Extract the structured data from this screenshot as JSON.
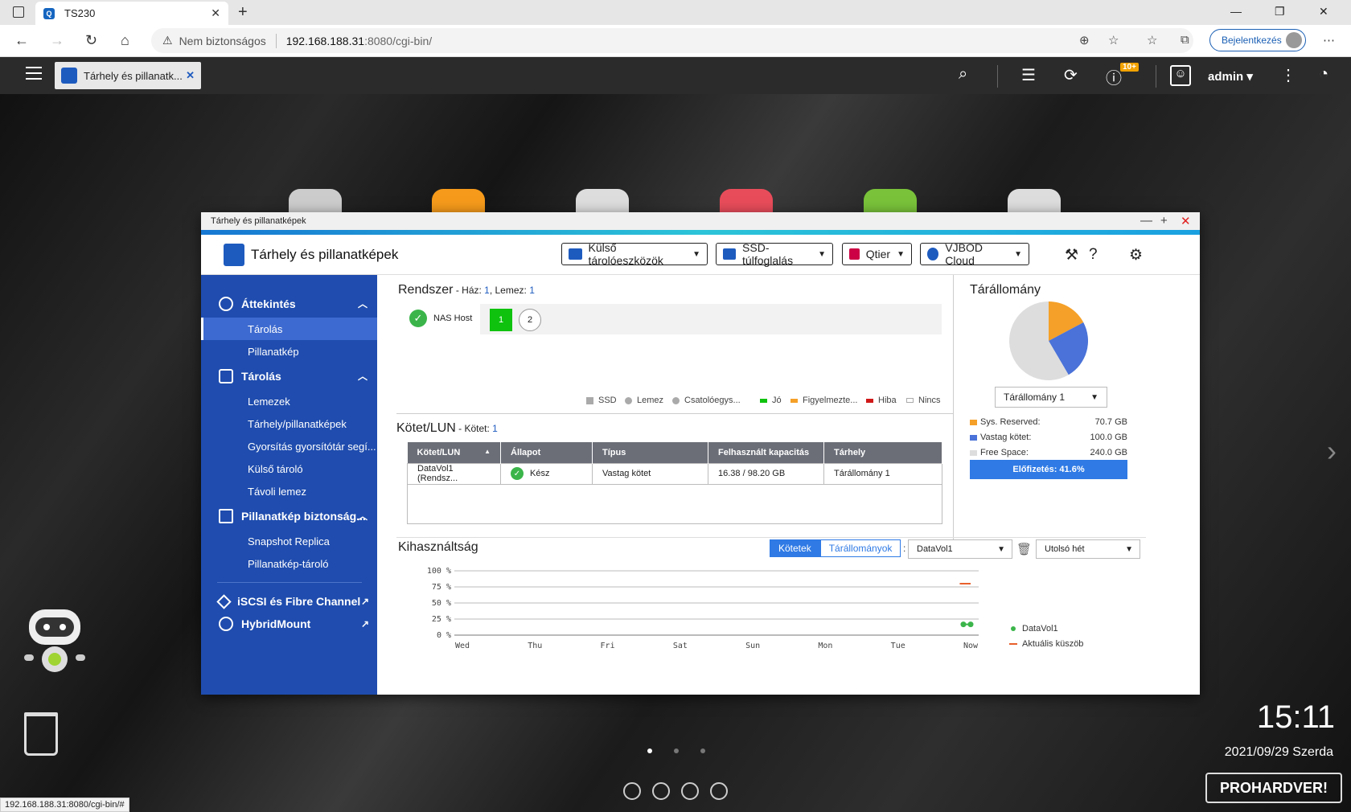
{
  "browser": {
    "tab_title": "TS230",
    "url_warning": "Nem biztonságos",
    "url_host": "192.168.188.31",
    "url_path": ":8080/cgi-bin/",
    "login_label": "Bejelentkezés",
    "status_url": "192.168.188.31:8080/cgi-bin/#"
  },
  "qts": {
    "app_tab": "Tárhely és pillanatk...",
    "badge": "10+",
    "user": "admin"
  },
  "window": {
    "titlebar": "Tárhely és pillanatképek",
    "app_name": "Tárhely és pillanatképek",
    "toolbar": {
      "external": "Külső tárolóeszközök",
      "ssd": "SSD-túlfoglalás",
      "qtier": "Qtier",
      "vjbod": "VJBOD Cloud"
    }
  },
  "sidebar": {
    "g1": "Áttekintés",
    "g1_items": [
      "Tárolás",
      "Pillanatkép"
    ],
    "g2": "Tárolás",
    "g2_items": [
      "Lemezek",
      "Tárhely/pillanatképek",
      "Gyorsítás gyorsítótár segí...",
      "Külső tároló",
      "Távoli lemez"
    ],
    "g3": "Pillanatkép biztonság...",
    "g3_items": [
      "Snapshot Replica",
      "Pillanatkép-tároló"
    ],
    "iscsi": "iSCSI és Fibre Channel",
    "hybrid": "HybridMount"
  },
  "system": {
    "title": "Rendszer",
    "meta_label": " - Ház: ",
    "enclosures": "1",
    "disk_label": ", Lemez: ",
    "disks": "1",
    "nas_host": "NAS Host",
    "slot1": "1",
    "slot2": "2",
    "legend": [
      "SSD",
      "Lemez",
      "Csatolóegys...",
      "Jó",
      "Figyelmezte...",
      "Hiba",
      "Nincs"
    ]
  },
  "volumes": {
    "title": "Kötet/LUN",
    "meta_label": " - Kötet: ",
    "count": "1",
    "headers": [
      "Kötet/LUN",
      "Állapot",
      "Típus",
      "Felhasznált kapacitás",
      "Tárhely"
    ],
    "sort_icon": "▲",
    "rows": [
      {
        "name": "DataVol1 (Rendsz...",
        "status": "Kész",
        "type": "Vastag kötet",
        "used": "16.38 / 98.20 GB",
        "pool": "Tárállomány 1"
      }
    ]
  },
  "pool": {
    "title": "Tárállomány",
    "selected": "Tárállomány 1",
    "rows": [
      {
        "label": "Sys. Reserved:",
        "value": "70.7 GB",
        "color": "#f5a028"
      },
      {
        "label": "Vastag kötet:",
        "value": "100.0 GB",
        "color": "#4a72d8"
      },
      {
        "label": "Free Space:",
        "value": "240.0 GB",
        "color": "#dddddd"
      }
    ],
    "provision": "Előfizetés: 41.6%"
  },
  "usage": {
    "title": "Kihasználtság",
    "tab_on": "Kötetek",
    "tab_off": "Tárállományok",
    "separator": ":",
    "volume_sel": "DataVol1",
    "range_sel": "Utolsó hét",
    "legend_vol": "DataVol1",
    "legend_thr": "Aktuális küszöb"
  },
  "chart_data": {
    "type": "line",
    "title": "",
    "x": [
      "Wed",
      "Thu",
      "Fri",
      "Sat",
      "Sun",
      "Mon",
      "Tue",
      "Now"
    ],
    "y_ticks": [
      "100 %",
      "75 %",
      "50 %",
      "25 %",
      "0 %"
    ],
    "ylim": [
      0,
      100
    ],
    "series": [
      {
        "name": "DataVol1",
        "color": "#3bb54a",
        "points": [
          [
            6.9,
            16.7
          ],
          [
            7.0,
            16.7
          ]
        ]
      },
      {
        "name": "Aktuális küszöb",
        "color": "#e8602c",
        "points": [
          [
            6.85,
            80
          ],
          [
            7.0,
            80
          ]
        ]
      }
    ]
  },
  "desktop": {
    "time": "15:11",
    "date": "2021/09/29 Szerda",
    "watermark": "PROHARDVER!"
  }
}
